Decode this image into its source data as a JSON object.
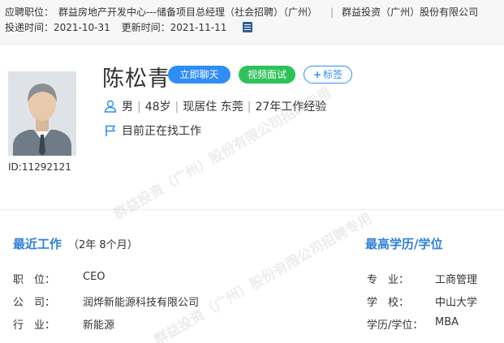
{
  "header": {
    "position_label": "应聘职位：",
    "position_value": "群益房地产开发中心---储备项目总经理（社会招聘）（广州）",
    "separator": "|",
    "company": "群益投资（广州）股份有限公司",
    "submitted_label": "投递时间：",
    "submitted_date": "2021-10-31",
    "updated_label": "更新时间：",
    "updated_date": "2021-11-11",
    "doc_icon": "document-icon"
  },
  "profile": {
    "id_text": "ID:11292121",
    "name": "陈松青",
    "gender": "男",
    "age": "48岁",
    "residence": "现居住 东莞",
    "experience": "27年工作经验",
    "job_status": "目前正在找工作",
    "separator": "|"
  },
  "actions": {
    "chat": "立即聊天",
    "video": "视频面试",
    "tag_plus": "+",
    "tag": "标签"
  },
  "recent_work": {
    "title": "最近工作",
    "duration": "（2年 8个月）",
    "rows": [
      {
        "label": "职　位：",
        "value": "CEO"
      },
      {
        "label": "公　司：",
        "value": "润烨新能源科技有限公司"
      },
      {
        "label": "行　业：",
        "value": "新能源"
      }
    ]
  },
  "education": {
    "title": "最高学历/学位",
    "rows": [
      {
        "label": "专　业：",
        "value": "工商管理"
      },
      {
        "label": "学　校：",
        "value": "中山大学"
      },
      {
        "label": "学历/学位：",
        "value": "MBA"
      }
    ]
  },
  "watermark": {
    "text1": "群益投资（广州）股份有限公司招聘专用",
    "text2": "群益投资（广州）股份有限公司招聘专用"
  },
  "colors": {
    "accent": "#2f8df6",
    "video": "#2fc15c",
    "section_title": "#2f7fd8"
  }
}
